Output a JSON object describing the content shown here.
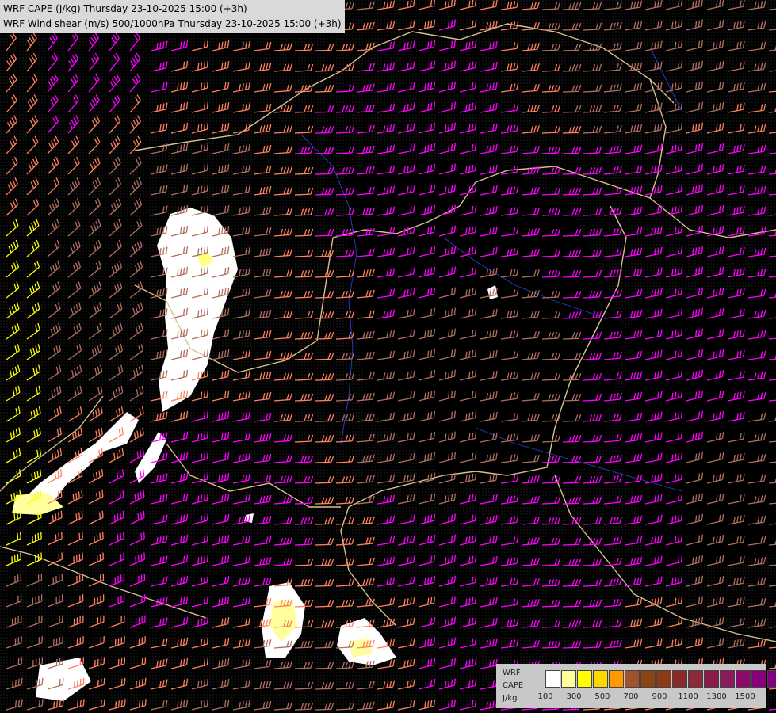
{
  "header": {
    "line1": "WRF CAPE (J/kg) Thursday 23-10-2025 15:00 (+3h)",
    "line2": "WRF Wind shear (m/s) 500/1000hPa Thursday 23-10-2025 15:00 (+3h)"
  },
  "legend": {
    "labels": [
      "WRF",
      "CAPE",
      "J/kg"
    ],
    "ticks": [
      "100",
      "300",
      "500",
      "700",
      "900",
      "1100",
      "1300",
      "1500"
    ],
    "colors": [
      "#ffffff",
      "#ffff9e",
      "#ffff00",
      "#ffd700",
      "#ff9900",
      "#a0522d",
      "#8b4513",
      "#8b3a1a",
      "#8b2a2a",
      "#8b2a3a",
      "#8b1a4a",
      "#8b1a5a",
      "#8b0a6a",
      "#8b007a",
      "#800080",
      "#7a0080"
    ]
  },
  "colors": {
    "background": "#000000",
    "barb_low": "#ffff00",
    "barb_mid": "#ff8060",
    "barb_high": "#ff00ff",
    "barb_brown": "#b07060",
    "border": "#d8c090",
    "river": "#3050ff"
  }
}
